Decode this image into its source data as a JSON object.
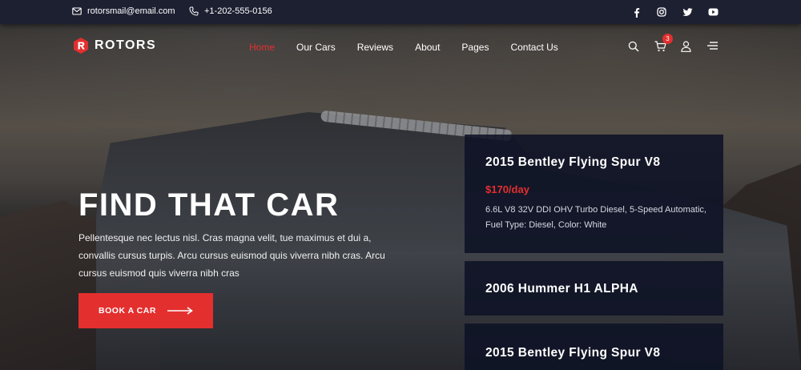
{
  "topbar": {
    "email": "rotorsmail@email.com",
    "phone": "+1-202-555-0156",
    "socials": [
      "facebook-icon",
      "instagram-icon",
      "twitter-icon",
      "youtube-icon"
    ]
  },
  "brand": {
    "name": "ROTORS",
    "accent": "#e42f2f"
  },
  "nav": {
    "items": [
      {
        "label": "Home",
        "active": true
      },
      {
        "label": "Our Cars",
        "active": false
      },
      {
        "label": "Reviews",
        "active": false
      },
      {
        "label": "About",
        "active": false
      },
      {
        "label": "Pages",
        "active": false
      },
      {
        "label": "Contact Us",
        "active": false
      }
    ],
    "cart_count": "3",
    "icons": [
      "search-icon",
      "cart-icon",
      "user-icon",
      "menu-icon"
    ]
  },
  "hero": {
    "title": "FIND THAT CAR",
    "description": "Pellentesque nec lectus nisl. Cras magna velit, tue maximus et dui a, convallis cursus turpis. Arcu cursus euismod quis viverra nibh cras. Arcu cursus euismod quis viverra nibh cras",
    "cta_label": "BOOK A CAR"
  },
  "cars": [
    {
      "title": "2015 Bentley Flying Spur V8",
      "price": "$170/day",
      "specs": "6.6L V8 32V DDI OHV Turbo Diesel, 5-Speed Automatic, Fuel Type: Diesel, Color: White"
    },
    {
      "title": "2006 Hummer H1 ALPHA"
    },
    {
      "title": "2015 Bentley Flying Spur V8"
    }
  ]
}
